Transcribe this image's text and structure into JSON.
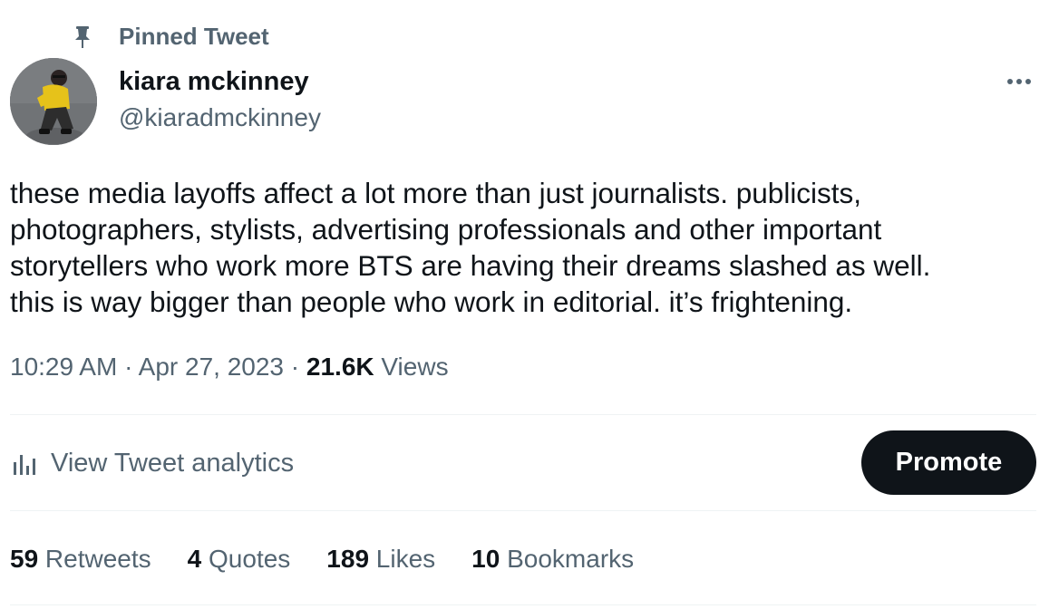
{
  "pinned": {
    "label": "Pinned Tweet",
    "icon": "pin-icon"
  },
  "author": {
    "display_name": "kiara mckinney",
    "handle": "@kiaradmckinney",
    "avatar_icon": "avatar-photo"
  },
  "more_icon": "more-horizontal-icon",
  "tweet": {
    "text": "these media layoffs affect a lot more than just journalists. publicists,\nphotographers, stylists, advertising professionals and other important\nstorytellers who work more BTS are having their dreams slashed as well.\nthis is way bigger than people who work in editorial. it’s frightening."
  },
  "meta": {
    "time": "10:29 AM",
    "sep1": " · ",
    "date": "Apr 27, 2023",
    "sep2": " · ",
    "views_count": "21.6K",
    "views_label": " Views"
  },
  "analytics": {
    "label": "View Tweet analytics",
    "icon": "analytics-bar-icon"
  },
  "promote": {
    "label": "Promote"
  },
  "stats": [
    {
      "count": "59",
      "label": " Retweets"
    },
    {
      "count": "4",
      "label": " Quotes"
    },
    {
      "count": "189",
      "label": " Likes"
    },
    {
      "count": "10",
      "label": " Bookmarks"
    }
  ],
  "colors": {
    "text_primary": "#0f1419",
    "text_secondary": "#536471",
    "divider": "#eff3f4",
    "button_bg": "#0f1419",
    "button_text": "#ffffff"
  }
}
